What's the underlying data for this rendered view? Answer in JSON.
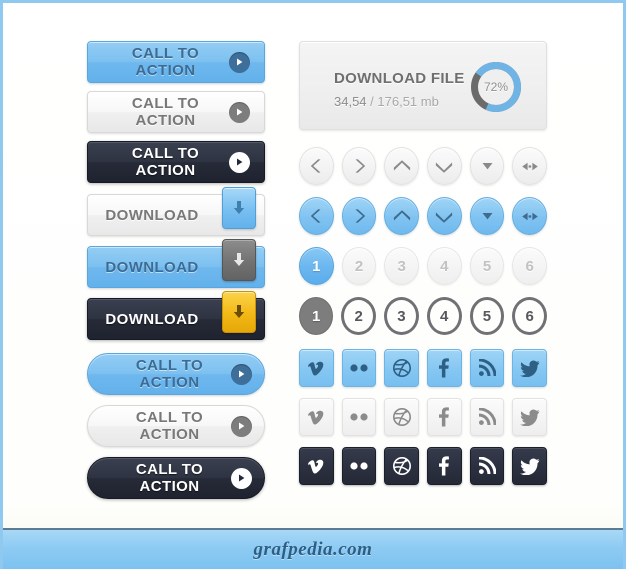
{
  "buttons": {
    "cta_label": "CALL TO ACTION",
    "download_label": "DOWNLOAD",
    "rect": [
      {
        "label": "CALL TO ACTION",
        "style": "blue",
        "icon": "play-icon"
      },
      {
        "label": "CALL TO ACTION",
        "style": "light",
        "icon": "play-icon"
      },
      {
        "label": "CALL TO ACTION",
        "style": "dark",
        "icon": "play-icon"
      }
    ],
    "download": [
      {
        "label": "DOWNLOAD",
        "style": "light",
        "tab": "blue",
        "icon": "download-arrow-icon"
      },
      {
        "label": "DOWNLOAD",
        "style": "blue",
        "tab": "gray",
        "icon": "download-arrow-icon"
      },
      {
        "label": "DOWNLOAD",
        "style": "dark",
        "tab": "gold",
        "icon": "download-arrow-icon"
      }
    ],
    "pill": [
      {
        "label": "CALL TO ACTION",
        "style": "blue",
        "icon": "play-icon"
      },
      {
        "label": "CALL TO ACTION",
        "style": "light",
        "icon": "play-icon"
      },
      {
        "label": "CALL TO ACTION",
        "style": "dark",
        "icon": "play-icon"
      }
    ]
  },
  "download_panel": {
    "title": "DOWNLOAD FILE",
    "downloaded": "34,54",
    "separator": " / ",
    "total": "176,51 mb",
    "progress_percent": 72,
    "progress_label": "72%",
    "ring_color": "#6fb4e5",
    "ring_track_color": "#6b6b6b"
  },
  "arrow_rows": [
    {
      "style": "light",
      "items": [
        {
          "icon": "chevron-left-icon"
        },
        {
          "icon": "chevron-right-icon"
        },
        {
          "icon": "chevron-up-icon"
        },
        {
          "icon": "chevron-down-icon"
        },
        {
          "icon": "triangle-down-icon"
        },
        {
          "icon": "expand-horizontal-icon"
        }
      ]
    },
    {
      "style": "blue",
      "items": [
        {
          "icon": "chevron-left-icon"
        },
        {
          "icon": "chevron-right-icon"
        },
        {
          "icon": "chevron-up-icon"
        },
        {
          "icon": "chevron-down-icon"
        },
        {
          "icon": "triangle-down-icon"
        },
        {
          "icon": "expand-horizontal-icon"
        }
      ]
    }
  ],
  "pagination": [
    {
      "style": "filled-blue",
      "active_index": 0,
      "pages": [
        "1",
        "2",
        "3",
        "4",
        "5",
        "6"
      ]
    },
    {
      "style": "outlined",
      "active_index": 0,
      "pages": [
        "1",
        "2",
        "3",
        "4",
        "5",
        "6"
      ]
    }
  ],
  "social_rows": [
    {
      "style": "blue",
      "items": [
        {
          "name": "vimeo",
          "icon": "vimeo-icon"
        },
        {
          "name": "flickr",
          "icon": "flickr-icon"
        },
        {
          "name": "dribbble",
          "icon": "dribbble-icon"
        },
        {
          "name": "facebook",
          "icon": "facebook-icon"
        },
        {
          "name": "rss",
          "icon": "rss-icon"
        },
        {
          "name": "twitter",
          "icon": "twitter-icon"
        }
      ]
    },
    {
      "style": "light",
      "items": [
        {
          "name": "vimeo",
          "icon": "vimeo-icon"
        },
        {
          "name": "flickr",
          "icon": "flickr-icon"
        },
        {
          "name": "dribbble",
          "icon": "dribbble-icon"
        },
        {
          "name": "facebook",
          "icon": "facebook-icon"
        },
        {
          "name": "rss",
          "icon": "rss-icon"
        },
        {
          "name": "twitter",
          "icon": "twitter-icon"
        }
      ]
    },
    {
      "style": "dark",
      "items": [
        {
          "name": "vimeo",
          "icon": "vimeo-icon"
        },
        {
          "name": "flickr",
          "icon": "flickr-icon"
        },
        {
          "name": "dribbble",
          "icon": "dribbble-icon"
        },
        {
          "name": "facebook",
          "icon": "facebook-icon"
        },
        {
          "name": "rss",
          "icon": "rss-icon"
        },
        {
          "name": "twitter",
          "icon": "twitter-icon"
        }
      ]
    }
  ],
  "footer": {
    "brand": "grafpedia.com"
  },
  "colors": {
    "accent_blue": "#7cc0f0",
    "dark_navy": "#2b3040",
    "gold": "#f2b816",
    "gray": "#7d7d7d"
  }
}
